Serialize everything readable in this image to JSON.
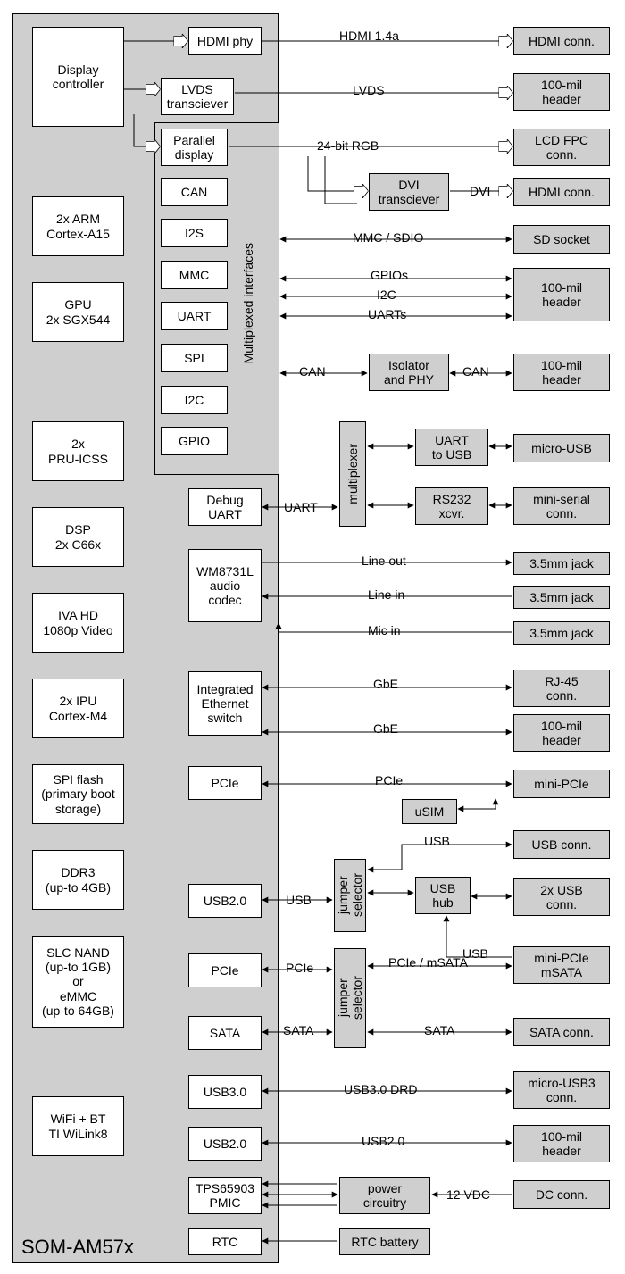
{
  "som": {
    "label": "SOM-AM57x"
  },
  "left_blocks": {
    "display": "Display\ncontroller",
    "cortex": "2x ARM\nCortex-A15",
    "gpu": "GPU\n2x SGX544",
    "pru": "2x\nPRU-ICSS",
    "dsp": "DSP\n2x C66x",
    "iva": "IVA HD\n1080p Video",
    "ipu": "2x IPU\nCortex-M4",
    "spiflash": "SPI flash\n(primary boot\nstorage)",
    "ddr3": "DDR3\n(up-to 4GB)",
    "nand": "SLC NAND\n(up-to 1GB)\nor\neMMC\n(up-to 64GB)",
    "wifi": "WiFi + BT\nTI WiLink8"
  },
  "mid_blocks": {
    "hdmi_phy": "HDMI phy",
    "lvds": "LVDS\ntransciever",
    "parallel": "Parallel\ndisplay",
    "can": "CAN",
    "i2s": "I2S",
    "mmc": "MMC",
    "uart": "UART",
    "spi": "SPI",
    "i2c": "I2C",
    "gpio": "GPIO",
    "mux_label": "Multiplexed interfaces",
    "debug_uart": "Debug\nUART",
    "audio": "WM8731L\naudio\ncodec",
    "eth": "Integrated\nEthernet\nswitch",
    "pcie1": "PCIe",
    "usb20_a": "USB2.0",
    "pcie2": "PCIe",
    "sata": "SATA",
    "usb30": "USB3.0",
    "usb20_b": "USB2.0",
    "pmic": "TPS65903\nPMIC",
    "rtc": "RTC"
  },
  "mid2_blocks": {
    "dvi": "DVI\ntransciever",
    "isolator": "Isolator\nand PHY",
    "mux1": "multiplexer",
    "uart_usb": "UART\nto USB",
    "rs232": "RS232\nxcvr.",
    "usim": "uSIM",
    "jumper1": "jumper\nselector",
    "usb_hub": "USB\nhub",
    "jumper2": "jumper\nselector",
    "power": "power\ncircuitry",
    "rtc_batt": "RTC battery"
  },
  "right_blocks": {
    "hdmi_conn1": "HDMI conn.",
    "hdr1": "100-mil\nheader",
    "lcd_fpc": "LCD FPC\nconn.",
    "hdmi_conn2": "HDMI conn.",
    "sd": "SD socket",
    "hdr2": "100-mil\nheader",
    "hdr3": "100-mil\nheader",
    "micro_usb": "micro-USB",
    "mini_serial": "mini-serial\nconn.",
    "jack1": "3.5mm jack",
    "jack2": "3.5mm jack",
    "jack3": "3.5mm jack",
    "rj45": "RJ-45\nconn.",
    "hdr4": "100-mil\nheader",
    "mini_pcie": "mini-PCIe",
    "usb_conn": "USB conn.",
    "usb2x": "2x USB\nconn.",
    "msata": "mini-PCIe\nmSATA",
    "sata_conn": "SATA conn.",
    "micro_usb3": "micro-USB3\nconn.",
    "hdr5": "100-mil\nheader",
    "dc_conn": "DC conn.",
    "empty": ""
  },
  "labels": {
    "hdmi14a": "HDMI 1.4a",
    "lvds": "LVDS",
    "rgb24": "24-bit RGB",
    "dvi": " DVI ",
    "mmc_sdio": "MMC / SDIO",
    "gpios": "GPIOs",
    "i2c": "I2C",
    "uarts": "UARTs",
    "can": "CAN",
    "can2": "CAN",
    "uart": "UART",
    "line_out": "Line out",
    "line_in": "Line in",
    "mic_in": "Mic in",
    "gbe1": "GbE",
    "gbe2": "GbE",
    "pcie": "PCIe",
    "usb": "USB",
    "usb2": "USB",
    "usb3": "USB",
    "pcie2": "PCIe",
    "pcie_msata": "PCIe / mSATA",
    "sata": "SATA",
    "sata2": "SATA",
    "usb30_drd": "USB3.0 DRD",
    "usb20": "USB2.0",
    "vdc12": "12 VDC"
  }
}
